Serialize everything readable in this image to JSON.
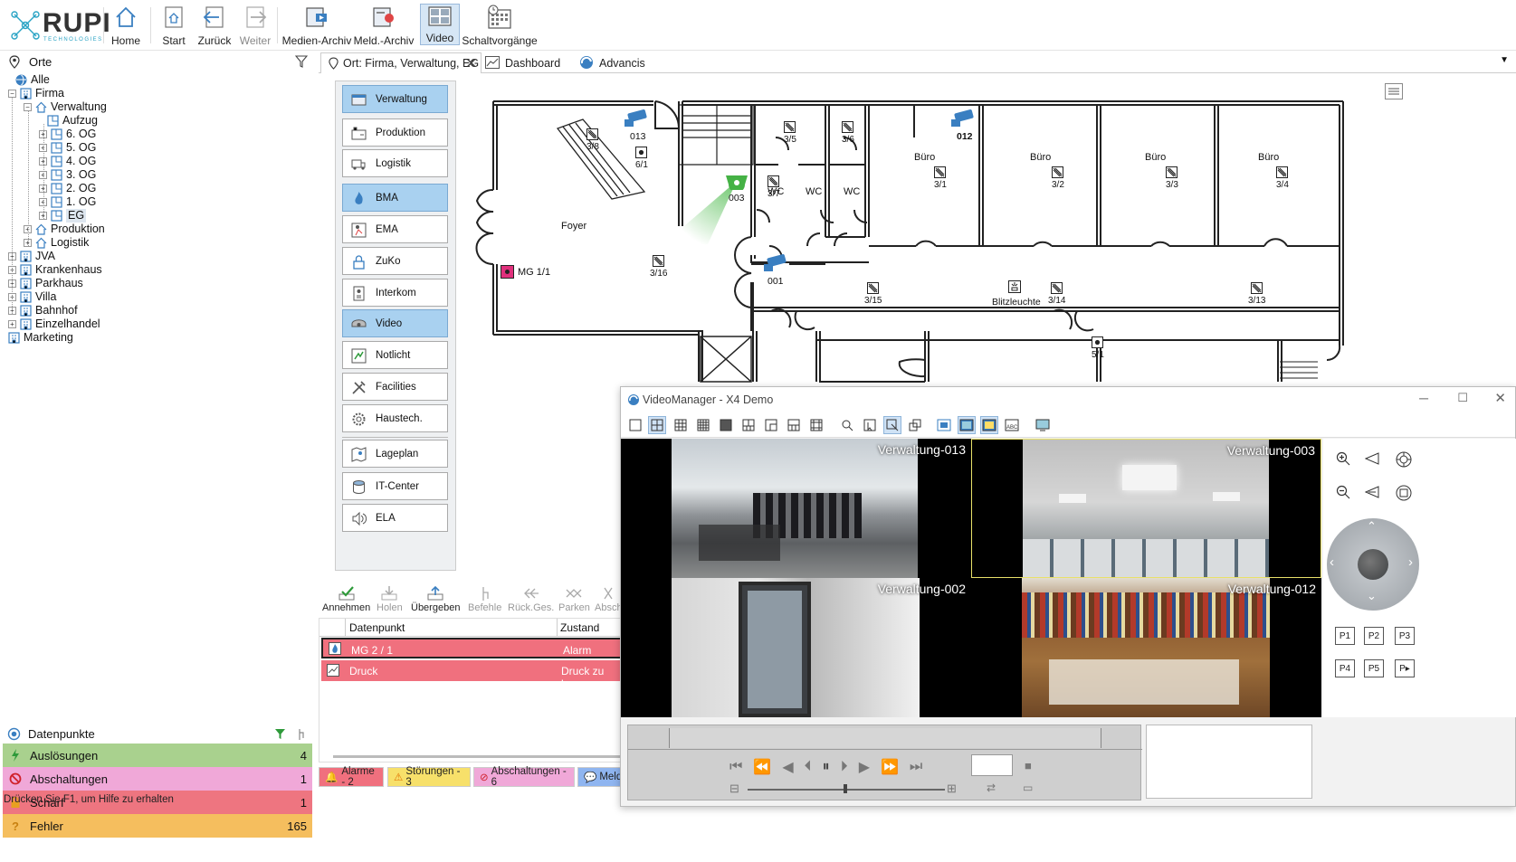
{
  "logo": {
    "name": "RUPI",
    "sub": "TECHNOLOGIES"
  },
  "toolbar": [
    {
      "id": "home",
      "label": "Home",
      "icon": "home-icon"
    },
    {
      "id": "start",
      "label": "Start",
      "icon": "start-icon"
    },
    {
      "id": "back",
      "label": "Zurück",
      "icon": "back-arrow-icon"
    },
    {
      "id": "forward",
      "label": "Weiter",
      "icon": "forward-arrow-icon"
    },
    {
      "id": "media",
      "label": "Medien-Archiv",
      "icon": "media-archive-icon"
    },
    {
      "id": "msg",
      "label": "Meld.-Archiv",
      "icon": "message-archive-icon"
    },
    {
      "id": "video",
      "label": "Video",
      "icon": "video-grid-icon"
    },
    {
      "id": "switch",
      "label": "Schaltvorgänge",
      "icon": "schedule-icon"
    }
  ],
  "tree": {
    "title": "Orte",
    "items": [
      {
        "label": "Alle"
      },
      {
        "label": "Firma"
      },
      {
        "label": "Verwaltung"
      },
      {
        "label": "Aufzug"
      },
      {
        "label": "6. OG"
      },
      {
        "label": "5. OG"
      },
      {
        "label": "4. OG"
      },
      {
        "label": "3. OG"
      },
      {
        "label": "2. OG"
      },
      {
        "label": "1. OG"
      },
      {
        "label": "EG"
      },
      {
        "label": "Produktion"
      },
      {
        "label": "Logistik"
      },
      {
        "label": "JVA"
      },
      {
        "label": "Krankenhaus"
      },
      {
        "label": "Parkhaus"
      },
      {
        "label": "Villa"
      },
      {
        "label": "Bahnhof"
      },
      {
        "label": "Einzelhandel"
      },
      {
        "label": "Marketing"
      }
    ]
  },
  "datapoints": {
    "title": "Datenpunkte",
    "rows": [
      {
        "label": "Auslösungen",
        "count": "4",
        "color": "#a9d18e"
      },
      {
        "label": "Abschaltungen",
        "count": "1",
        "color": "#f0a8d8"
      },
      {
        "label": "Scharf",
        "count": "1",
        "color": "#ee7580"
      },
      {
        "label": "Fehler",
        "count": "165",
        "color": "#f5be5e"
      }
    ]
  },
  "status_text": "Drücken Sie F1, um Hilfe zu erhalten",
  "tabs": [
    {
      "label": "Ort: Firma, Verwaltung, EG"
    },
    {
      "label": "Dashboard"
    },
    {
      "label": "Advancis"
    }
  ],
  "categories": [
    {
      "label": "Verwaltung",
      "active": true,
      "icon": "folder-icon"
    },
    {
      "label": "Produktion",
      "active": false,
      "icon": "production-icon"
    },
    {
      "label": "Logistik",
      "active": false,
      "icon": "truck-icon"
    },
    {
      "label": "BMA",
      "active": true,
      "icon": "fire-icon"
    },
    {
      "label": "EMA",
      "active": false,
      "icon": "intrusion-icon"
    },
    {
      "label": "ZuKo",
      "active": false,
      "icon": "lock-icon"
    },
    {
      "label": "Interkom",
      "active": false,
      "icon": "intercom-icon"
    },
    {
      "label": "Video",
      "active": true,
      "icon": "camera-icon"
    },
    {
      "label": "Notlicht",
      "active": false,
      "icon": "emergency-light-icon"
    },
    {
      "label": "Facilities",
      "active": false,
      "icon": "tools-icon"
    },
    {
      "label": "Haustech.",
      "active": false,
      "icon": "gear-icon"
    },
    {
      "label": "Lageplan",
      "active": false,
      "icon": "map-icon"
    },
    {
      "label": "IT-Center",
      "active": false,
      "icon": "database-icon"
    },
    {
      "label": "ELA",
      "active": false,
      "icon": "speaker-icon"
    }
  ],
  "map": {
    "labels": [
      "Foyer",
      "Büro",
      "Büro",
      "Büro",
      "Büro",
      "WC",
      "WC",
      "WC",
      "Blitzleuchte"
    ],
    "detectors": [
      "3/8",
      "6/1",
      "3/5",
      "3/6",
      "3/7",
      "3/1",
      "3/2",
      "3/3",
      "3/4",
      "3/16",
      "3/15",
      "3/14",
      "3/13",
      "5/1"
    ],
    "cameras": [
      "013",
      "003",
      "012",
      "001"
    ],
    "alarm_point": "MG 1/1"
  },
  "alarm_toolbar": [
    {
      "label": "Annehmen",
      "enabled": true
    },
    {
      "label": "Holen",
      "enabled": false
    },
    {
      "label": "Übergeben",
      "enabled": true
    },
    {
      "label": "Befehle",
      "enabled": false
    },
    {
      "label": "Rück.Ges.",
      "enabled": false
    },
    {
      "label": "Parken",
      "enabled": false
    },
    {
      "label": "Absch",
      "enabled": false
    }
  ],
  "alarm_table": {
    "headers": [
      "Datenpunkt",
      "Zustand"
    ],
    "rows": [
      {
        "point": "MG 2 / 1",
        "state": "Alarm"
      },
      {
        "point": "Druck",
        "state": "Druck zu hoc"
      }
    ]
  },
  "bottom_tabs": [
    {
      "label": "Alarme - 2",
      "color": "#f0707e"
    },
    {
      "label": "Störungen - 3",
      "color": "#f7e06a"
    },
    {
      "label": "Abschaltungen - 6",
      "color": "#f0a8d8"
    },
    {
      "label": "Meldu",
      "color": "#8fb5f0"
    }
  ],
  "videomanager": {
    "title": "VideoManager - X4 Demo",
    "cells": [
      {
        "label": "Verwaltung-013"
      },
      {
        "label": "Verwaltung-003"
      },
      {
        "label": "Verwaltung-002"
      },
      {
        "label": "Verwaltung-012"
      }
    ],
    "presets": [
      "P1",
      "P2",
      "P3",
      "P4",
      "P5",
      "P▸"
    ]
  }
}
